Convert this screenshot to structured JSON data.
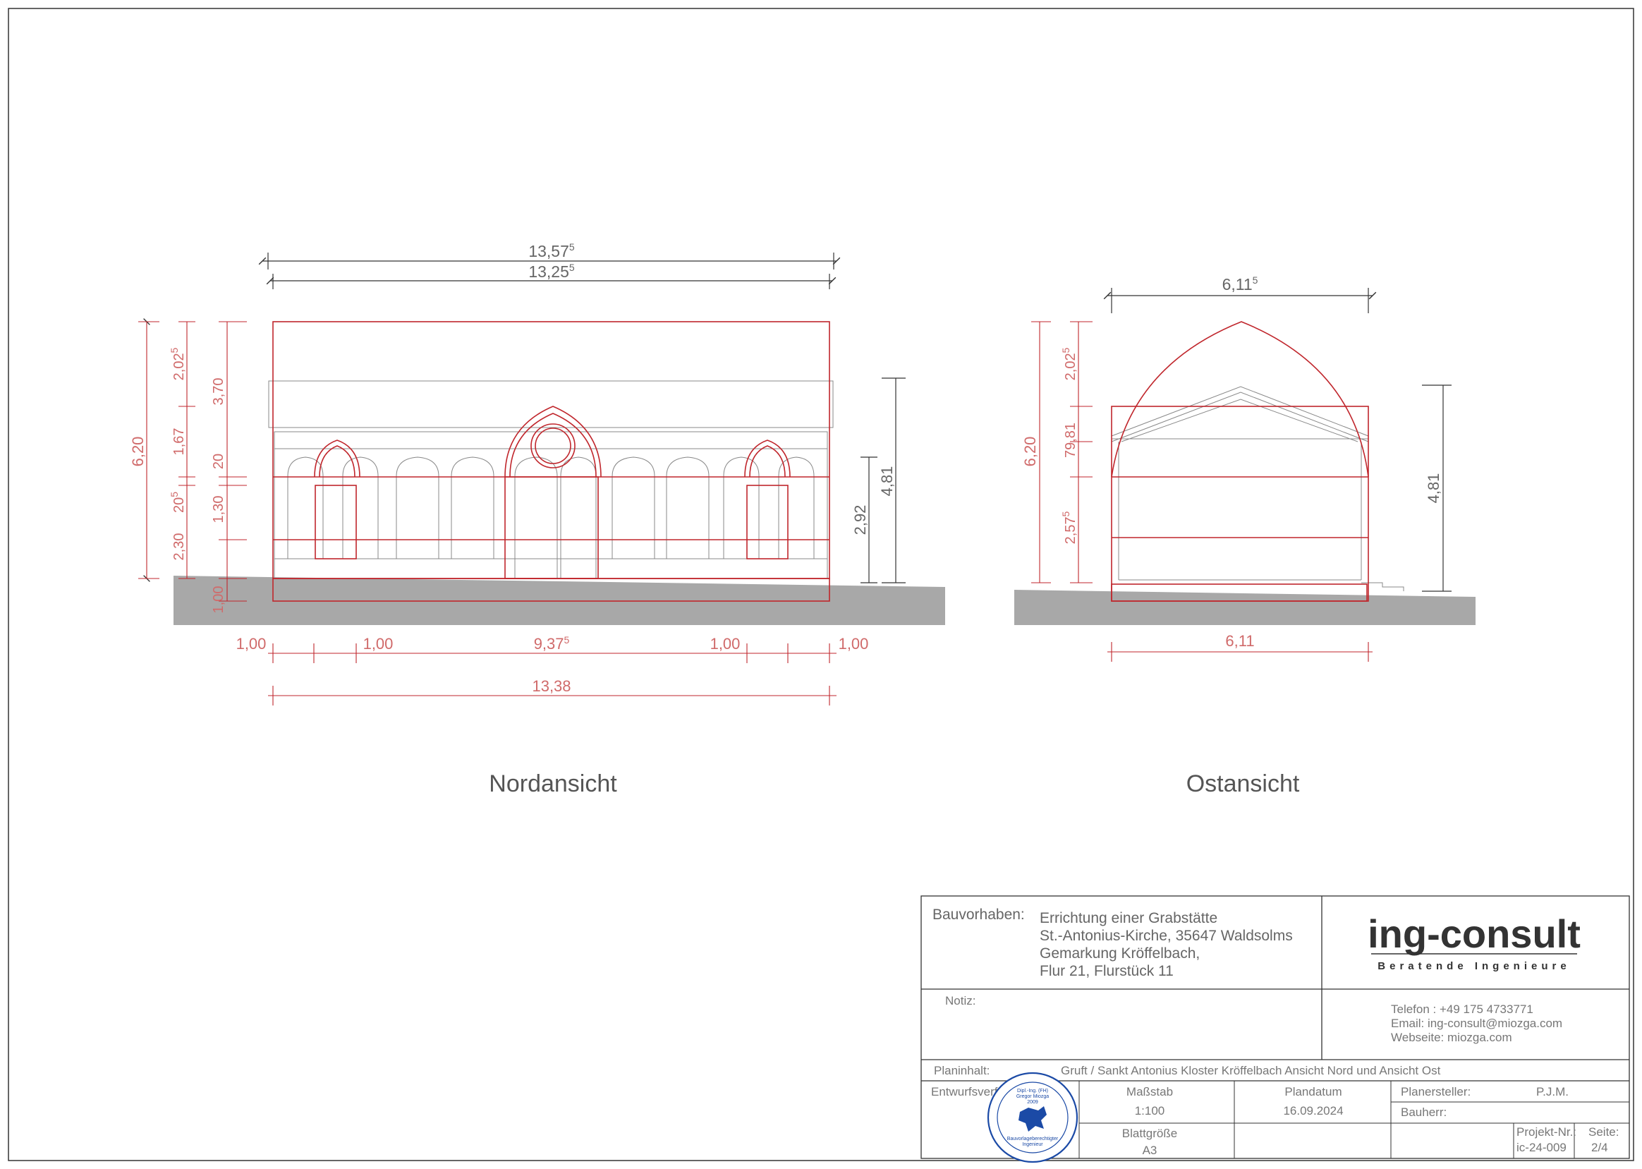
{
  "nord": {
    "title": "Nordansicht",
    "dim_top_overall": {
      "main": "13,57",
      "sup": "5"
    },
    "dim_top_inner": {
      "main": "13,25",
      "sup": "5"
    },
    "left_total": "6,20",
    "left_a": {
      "main": "2,02",
      "sup": "5"
    },
    "left_b": "1,67",
    "left_c": {
      "main": "20",
      "sup": "5"
    },
    "left_d": "2,30",
    "left_e": "3,70",
    "left_f": "20",
    "left_g": "1,30",
    "left_h": "1,00",
    "right_a": "4,81",
    "right_b": "2,92",
    "bottom_1": "1,00",
    "bottom_2": "1,00",
    "bottom_3": {
      "main": "9,37",
      "sup": "5"
    },
    "bottom_4": "1,00",
    "bottom_5": "1,00",
    "bottom_total": "13,38"
  },
  "ost": {
    "title": "Ostansicht",
    "dim_top": {
      "main": "6,11",
      "sup": "5"
    },
    "left_total": "6,20",
    "left_a": {
      "main": "2,02",
      "sup": "5"
    },
    "left_b": "79,81",
    "left_c": {
      "main": "2,57",
      "sup": "5"
    },
    "right_a": "4,81",
    "bottom": "6,11"
  },
  "titleblock": {
    "bauvorhaben_label": "Bauvorhaben:",
    "bauvorhaben_lines": [
      "Errichtung einer Grabstätte",
      "St.-Antonius-Kirche, 35647 Waldsolms",
      "Gemarkung Kröffelbach,",
      "Flur 21, Flurstück 11"
    ],
    "logo": "ing-consult",
    "logo_sub": "Beratende Ingenieure",
    "notiz_label": "Notiz:",
    "contact": [
      "Telefon :  +49 175  4733771",
      "Email:  ing-consult@miozga.com",
      "Webseite:  miozga.com"
    ],
    "planinhalt_label": "Planinhalt:",
    "planinhalt": "Gruft / Sankt Antonius Kloster Kröffelbach   Ansicht Nord und Ansicht  Ost",
    "entwurf_label": "Entwurfsverf.",
    "massstab_label": "Maßstab",
    "massstab": "1:100",
    "plandatum_label": "Plandatum",
    "plandatum": "16.09.2024",
    "planersteller_label": "Planersteller:",
    "planersteller": "P.J.M.",
    "bauherr_label": "Bauherr:",
    "blattgroesse_label": "Blattgröße",
    "blattgroesse": "A3",
    "projekt_label": "Projekt-Nr.:",
    "projekt": "ic-24-009",
    "seite_label": "Seite:",
    "seite": "2/4",
    "stamp_name1": "Dipl.-Ing. (FH)",
    "stamp_name2": "Gregor Miozga",
    "stamp_year": "2009",
    "stamp_role1": "Bauvorlageberechtigter",
    "stamp_role2": "Ingenieur"
  }
}
